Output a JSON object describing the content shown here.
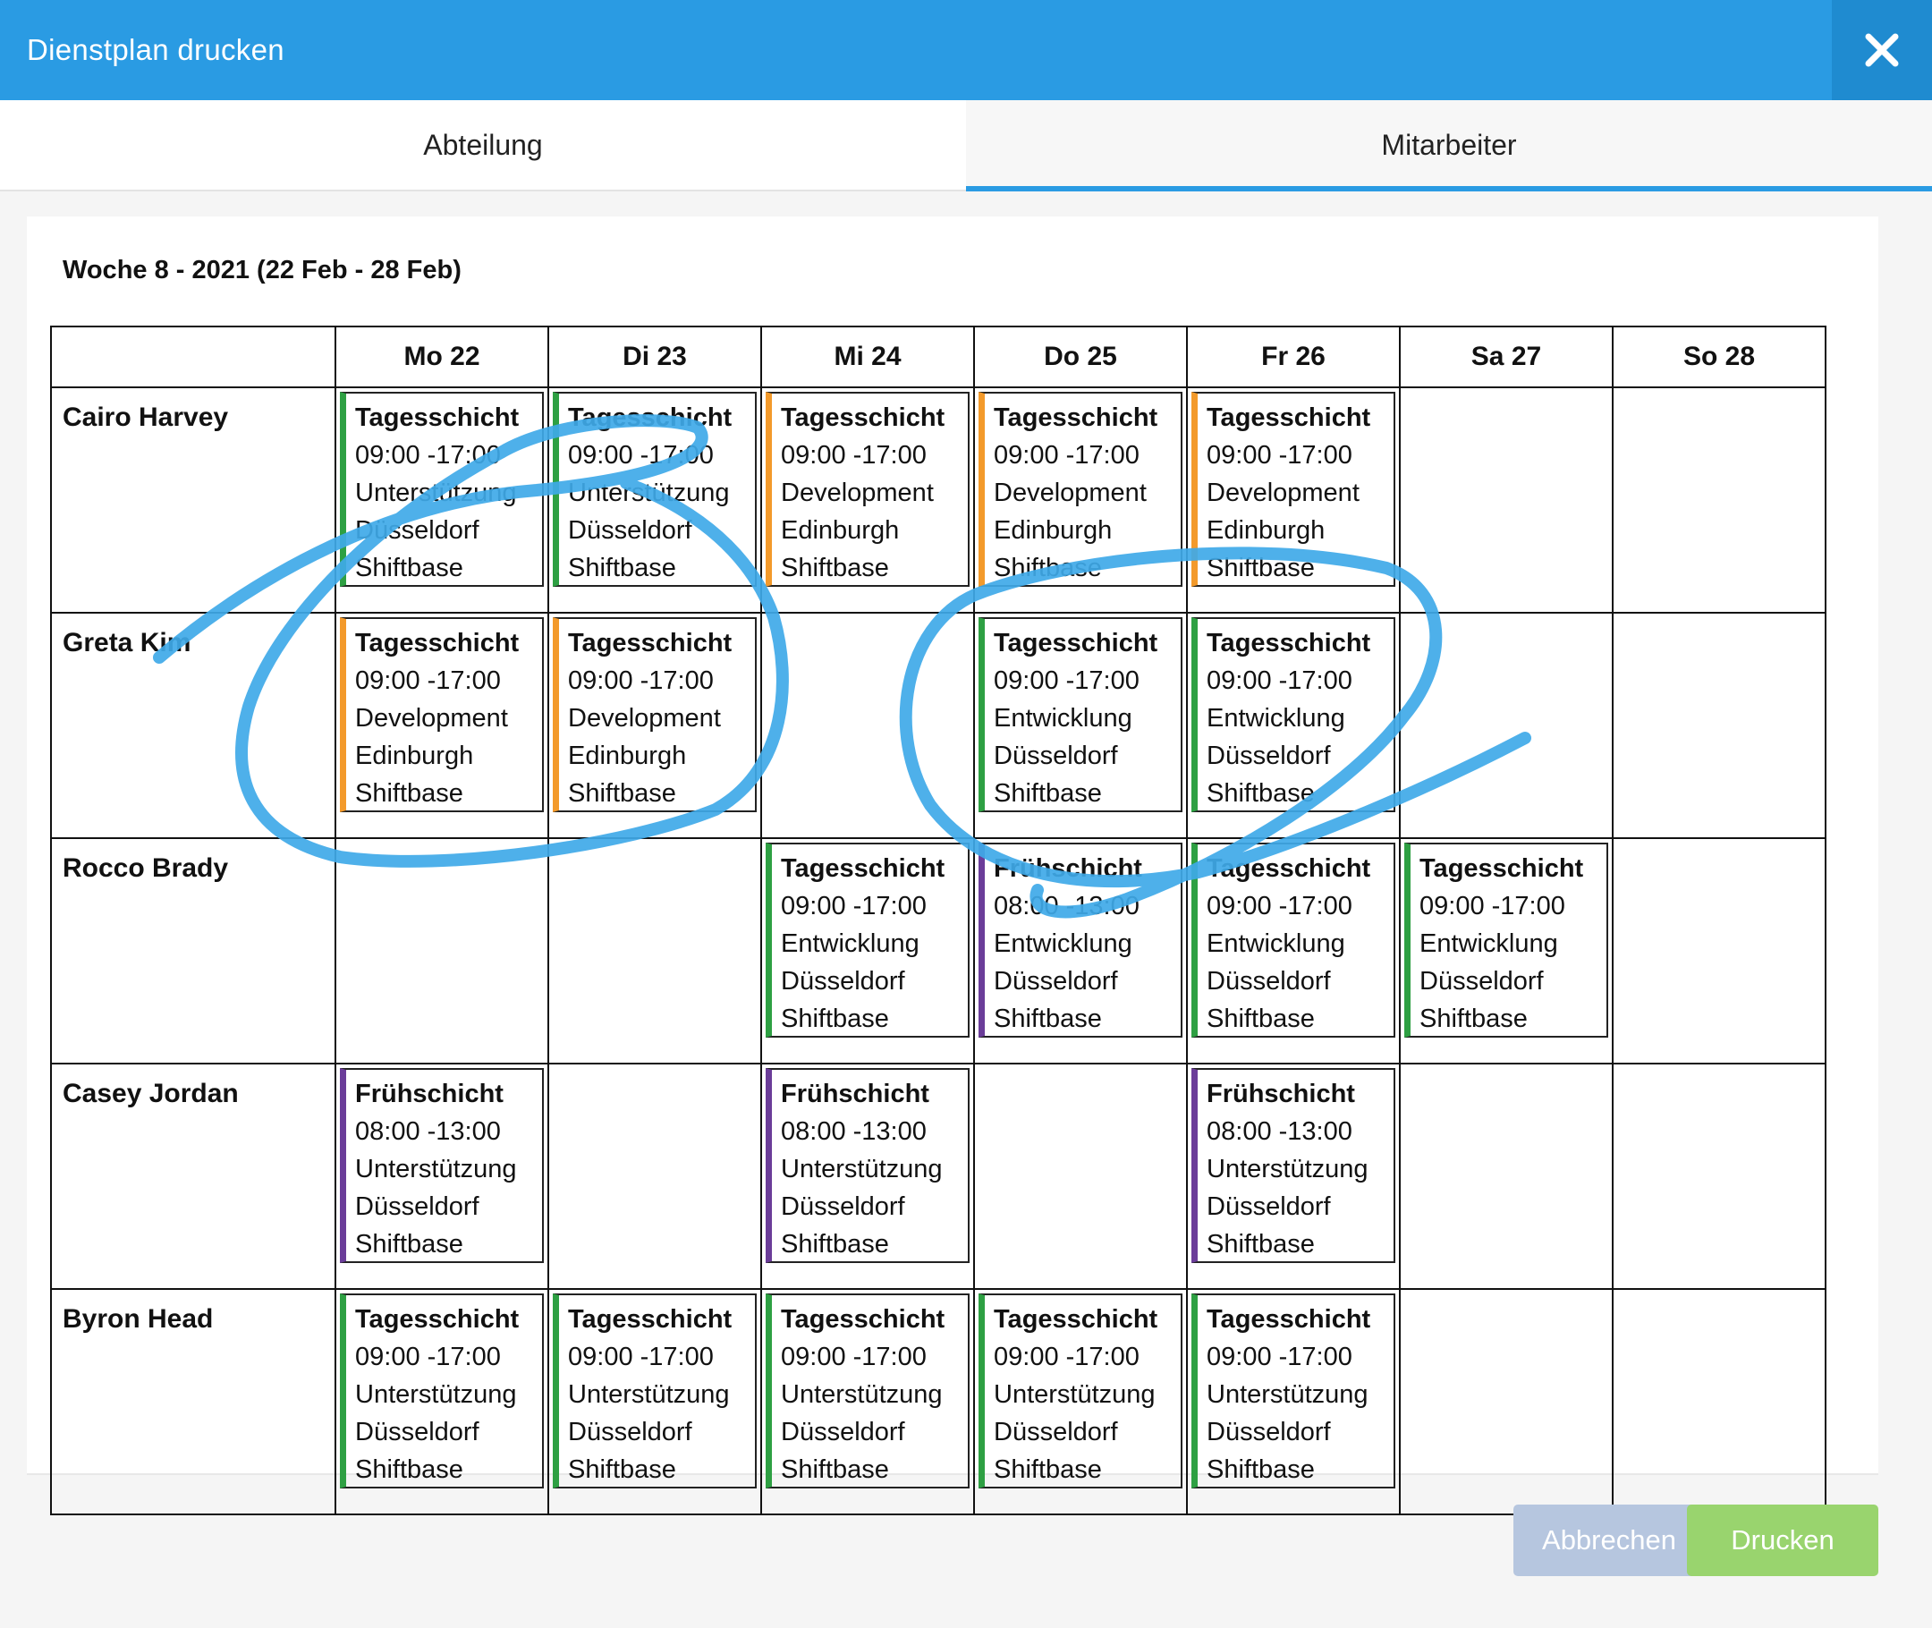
{
  "header": {
    "title": "Dienstplan drucken",
    "close_icon": "close-icon"
  },
  "tabs": [
    {
      "label": "Abteilung",
      "active": false
    },
    {
      "label": "Mitarbeiter",
      "active": true
    }
  ],
  "week_title": "Woche 8 - 2021 (22 Feb - 28 Feb)",
  "days": [
    "Mo 22",
    "Di 23",
    "Mi 24",
    "Do 25",
    "Fr 26",
    "Sa 27",
    "So 28"
  ],
  "colors": {
    "header": "#2a9be3",
    "green": "#2ea043",
    "orange": "#f39a2b",
    "purple": "#6b3d99",
    "annotation": "#3fa9e8",
    "print_button": "#99d46e",
    "cancel_button": "#b6c6df"
  },
  "employees": [
    {
      "name": "Cairo Harvey",
      "shifts": [
        {
          "day": 0,
          "name": "Tagesschicht",
          "time": "09:00 -17:00",
          "department": "Unterstützung",
          "location": "Düsseldorf",
          "company": "Shiftbase",
          "color": "green"
        },
        {
          "day": 1,
          "name": "Tagesschicht",
          "time": "09:00 -17:00",
          "department": "Unterstützung",
          "location": "Düsseldorf",
          "company": "Shiftbase",
          "color": "green"
        },
        {
          "day": 2,
          "name": "Tagesschicht",
          "time": "09:00 -17:00",
          "department": "Development",
          "location": "Edinburgh",
          "company": "Shiftbase",
          "color": "orange"
        },
        {
          "day": 3,
          "name": "Tagesschicht",
          "time": "09:00 -17:00",
          "department": "Development",
          "location": "Edinburgh",
          "company": "Shiftbase",
          "color": "orange"
        },
        {
          "day": 4,
          "name": "Tagesschicht",
          "time": "09:00 -17:00",
          "department": "Development",
          "location": "Edinburgh",
          "company": "Shiftbase",
          "color": "orange"
        }
      ]
    },
    {
      "name": "Greta Kim",
      "shifts": [
        {
          "day": 0,
          "name": "Tagesschicht",
          "time": "09:00 -17:00",
          "department": "Development",
          "location": "Edinburgh",
          "company": "Shiftbase",
          "color": "orange"
        },
        {
          "day": 1,
          "name": "Tagesschicht",
          "time": "09:00 -17:00",
          "department": "Development",
          "location": "Edinburgh",
          "company": "Shiftbase",
          "color": "orange"
        },
        {
          "day": 3,
          "name": "Tagesschicht",
          "time": "09:00 -17:00",
          "department": "Entwicklung",
          "location": "Düsseldorf",
          "company": "Shiftbase",
          "color": "green"
        },
        {
          "day": 4,
          "name": "Tagesschicht",
          "time": "09:00 -17:00",
          "department": "Entwicklung",
          "location": "Düsseldorf",
          "company": "Shiftbase",
          "color": "green"
        }
      ]
    },
    {
      "name": "Rocco Brady",
      "shifts": [
        {
          "day": 2,
          "name": "Tagesschicht",
          "time": "09:00 -17:00",
          "department": "Entwicklung",
          "location": "Düsseldorf",
          "company": "Shiftbase",
          "color": "green"
        },
        {
          "day": 3,
          "name": "Frühschicht",
          "time": "08:00 -13:00",
          "department": "Entwicklung",
          "location": "Düsseldorf",
          "company": "Shiftbase",
          "color": "purple"
        },
        {
          "day": 4,
          "name": "Tagesschicht",
          "time": "09:00 -17:00",
          "department": "Entwicklung",
          "location": "Düsseldorf",
          "company": "Shiftbase",
          "color": "green"
        },
        {
          "day": 5,
          "name": "Tagesschicht",
          "time": "09:00 -17:00",
          "department": "Entwicklung",
          "location": "Düsseldorf",
          "company": "Shiftbase",
          "color": "green"
        }
      ]
    },
    {
      "name": "Casey Jordan",
      "shifts": [
        {
          "day": 0,
          "name": "Frühschicht",
          "time": "08:00 -13:00",
          "department": "Unterstützung",
          "location": "Düsseldorf",
          "company": "Shiftbase",
          "color": "purple"
        },
        {
          "day": 2,
          "name": "Frühschicht",
          "time": "08:00 -13:00",
          "department": "Unterstützung",
          "location": "Düsseldorf",
          "company": "Shiftbase",
          "color": "purple"
        },
        {
          "day": 4,
          "name": "Frühschicht",
          "time": "08:00 -13:00",
          "department": "Unterstützung",
          "location": "Düsseldorf",
          "company": "Shiftbase",
          "color": "purple"
        }
      ]
    },
    {
      "name": "Byron Head",
      "shifts": [
        {
          "day": 0,
          "name": "Tagesschicht",
          "time": "09:00 -17:00",
          "department": "Unterstützung",
          "location": "Düsseldorf",
          "company": "Shiftbase",
          "color": "green"
        },
        {
          "day": 1,
          "name": "Tagesschicht",
          "time": "09:00 -17:00",
          "department": "Unterstützung",
          "location": "Düsseldorf",
          "company": "Shiftbase",
          "color": "green"
        },
        {
          "day": 2,
          "name": "Tagesschicht",
          "time": "09:00 -17:00",
          "department": "Unterstützung",
          "location": "Düsseldorf",
          "company": "Shiftbase",
          "color": "green"
        },
        {
          "day": 3,
          "name": "Tagesschicht",
          "time": "09:00 -17:00",
          "department": "Unterstützung",
          "location": "Düsseldorf",
          "company": "Shiftbase",
          "color": "green"
        },
        {
          "day": 4,
          "name": "Tagesschicht",
          "time": "09:00 -17:00",
          "department": "Unterstützung",
          "location": "Düsseldorf",
          "company": "Shiftbase",
          "color": "green"
        }
      ]
    }
  ],
  "footer": {
    "cancel_label": "Abbrechen",
    "print_label": "Drucken"
  }
}
